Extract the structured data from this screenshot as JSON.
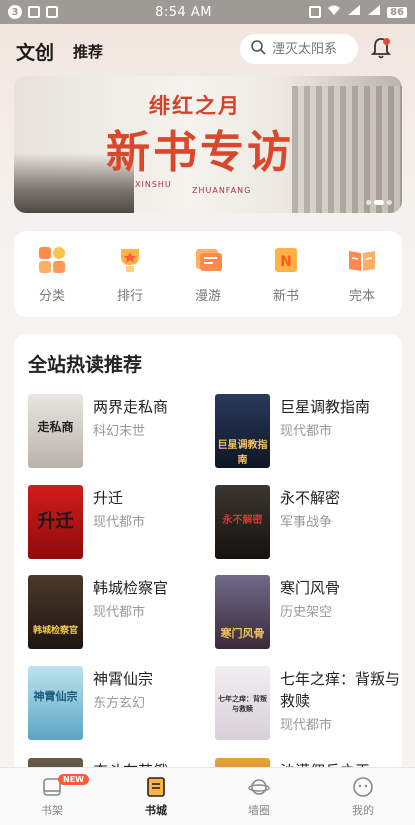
{
  "status_bar": {
    "time": "8:54 AM",
    "notification_count": "3",
    "battery": "86"
  },
  "header": {
    "title": "文创",
    "tab": "推荐",
    "search_placeholder": "湮灭太阳系"
  },
  "banner": {
    "top_text": "绯红之月",
    "main_text": "新书专访",
    "pinyin_1": "XINSHU",
    "pinyin_2": "ZHUANFANG"
  },
  "categories": [
    {
      "label": "分类",
      "icon": "grid-icon"
    },
    {
      "label": "排行",
      "icon": "trophy-icon"
    },
    {
      "label": "漫游",
      "icon": "roam-icon"
    },
    {
      "label": "新书",
      "icon": "new-book-icon"
    },
    {
      "label": "完本",
      "icon": "open-book-icon"
    }
  ],
  "hot": {
    "title": "全站热读推荐",
    "books": [
      {
        "title": "两界走私商",
        "genre": "科幻末世",
        "cover_text": "走私商"
      },
      {
        "title": "巨星调教指南",
        "genre": "现代都市",
        "cover_text": "巨星调教指南"
      },
      {
        "title": "升迁",
        "genre": "现代都市",
        "cover_text": "升迁"
      },
      {
        "title": "永不解密",
        "genre": "军事战争",
        "cover_text": "永不解密"
      },
      {
        "title": "韩城检察官",
        "genre": "现代都市",
        "cover_text": "韩城检察官"
      },
      {
        "title": "寒门风骨",
        "genre": "历史架空",
        "cover_text": "寒门风骨"
      },
      {
        "title": "神霄仙宗",
        "genre": "东方玄幻",
        "cover_text": "神霄仙宗"
      },
      {
        "title": "七年之痒：背叛与救赎",
        "genre": "现代都市",
        "cover_text": "七年之痒：背叛与救赎"
      },
      {
        "title": "奋斗在苦俄",
        "genre": "",
        "cover_text": ""
      },
      {
        "title": "沙漠佣兵之王",
        "genre": "",
        "cover_text": ""
      }
    ]
  },
  "tabbar": {
    "items": [
      {
        "label": "书架",
        "badge": "NEW"
      },
      {
        "label": "书城"
      },
      {
        "label": "墙圈"
      },
      {
        "label": "我的"
      }
    ]
  }
}
